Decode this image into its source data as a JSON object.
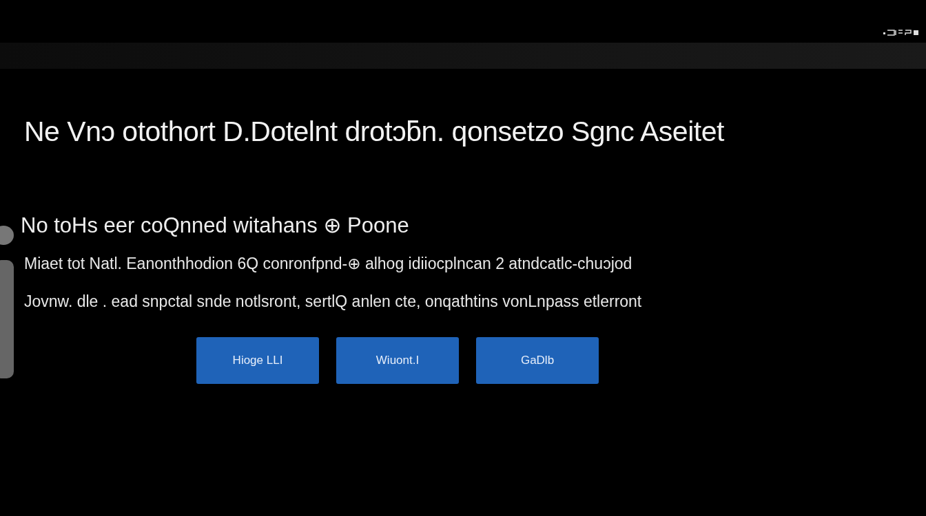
{
  "title": "Ne Vnɔ otothort D.Dotelnt drotɔƃn.  qonsetzo Sgnc Aseitet",
  "subtitle": "No toHs eer coQnned witahans ⊕ Poone",
  "body": [
    "Miaet tot Natl. Eanonthhodion 6Q conronfpnd-⊕ alhog idiiocplncan  2 atndcatlc-chuɔjod",
    "Jovnw. dle . ead snpctal snde notlsront,  sertlQ anlen cte,  onqathtins vonLnpass etlerront"
  ],
  "buttons": [
    "Hioge LLI",
    "Wiuont.I",
    "GaDlb"
  ]
}
